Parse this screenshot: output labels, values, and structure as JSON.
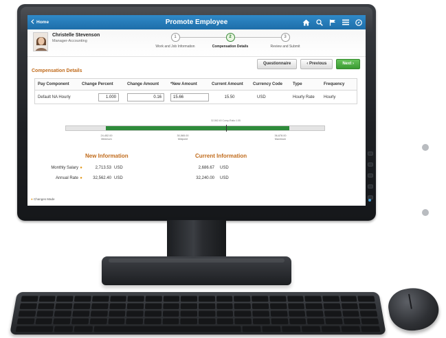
{
  "app": {
    "home_label": "Home",
    "title": "Promote Employee",
    "icons": [
      "home-icon",
      "search-icon",
      "flag-icon",
      "menu-icon",
      "compass-icon"
    ]
  },
  "employee": {
    "name": "Christelle Stevenson",
    "title": "Manager-Accounting"
  },
  "steps": [
    {
      "number": "1",
      "label": "Work and Job Information",
      "active": false
    },
    {
      "number": "2",
      "label": "Compensation Details",
      "active": true
    },
    {
      "number": "3",
      "label": "Review and Submit",
      "active": false
    }
  ],
  "buttons": {
    "questionnaire": "Questionnaire",
    "previous": "Previous",
    "next": "Next"
  },
  "section_title": "Compensation Details",
  "table": {
    "columns": [
      "Pay Component",
      "Change Percent",
      "Change Amount",
      "*New Amount",
      "Current Amount",
      "Currency Code",
      "Type",
      "Frequency"
    ],
    "rows": [
      {
        "pay_component": "Default NA Hourly",
        "change_percent": "1.000",
        "change_amount": "0.16",
        "new_amount": "15.66",
        "current_amount": "15.50",
        "currency_code": "USD",
        "type": "Hourly Rate",
        "frequency": "Hourly"
      }
    ]
  },
  "range": {
    "caption": "32,562.40 Comp-Ratio:1.05",
    "minimum_value": "24,452.00",
    "minimum_label": "Minimum",
    "midpoint_value": "30,565.00",
    "midpoint_label": "Midpoint",
    "maximum_value": "36,678.00",
    "maximum_label": "Maximum",
    "fill_start_fraction": 0.155,
    "fill_end_fraction": 0.865,
    "marker_fraction": 0.62
  },
  "info": {
    "new_heading": "New Information",
    "current_heading": "Current Information",
    "rows": [
      {
        "label": "Monthly Salary",
        "new_value": "2,713.53",
        "new_unit": "USD",
        "current_value": "2,686.67",
        "current_unit": "USD"
      },
      {
        "label": "Annual Rate",
        "new_value": "32,562.40",
        "new_unit": "USD",
        "current_value": "32,240.00",
        "current_unit": "USD"
      }
    ],
    "changed_marker": "●",
    "legend_label": "Changes Made"
  },
  "colors": {
    "header_blue": "#2f8ac9",
    "accent_orange": "#c06a1a",
    "next_green": "#3a9a32",
    "range_green": "#2e8b3a",
    "changed_marker": "#e39a1e"
  }
}
